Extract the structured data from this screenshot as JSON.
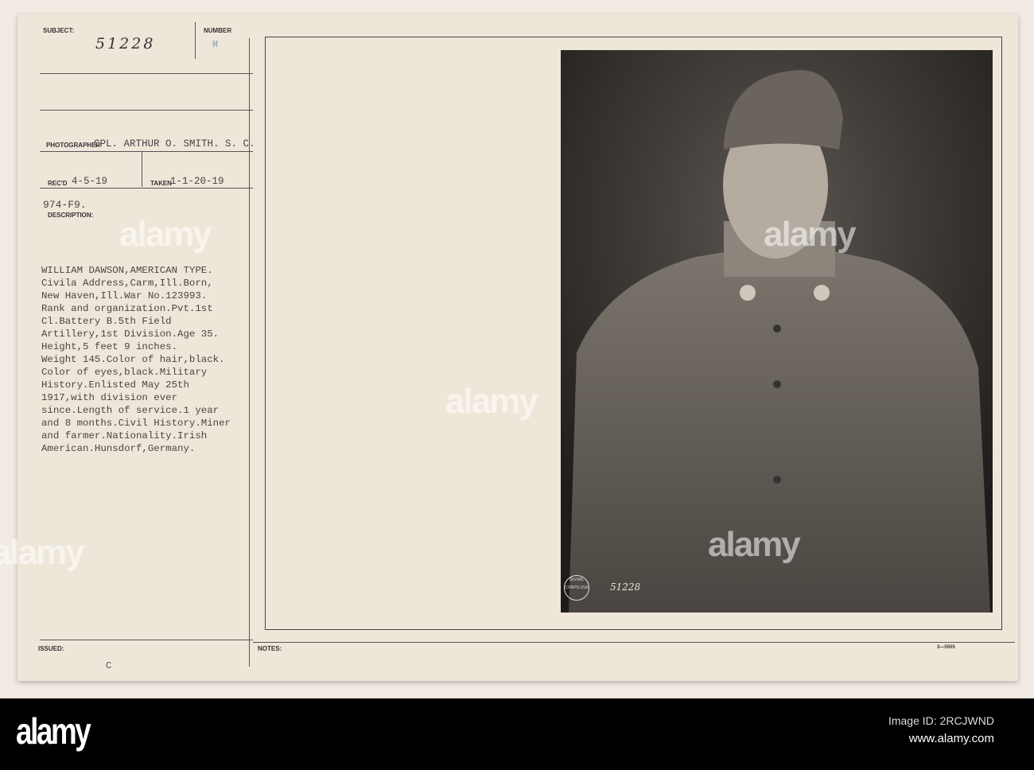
{
  "card": {
    "subject_label": "SUBJECT:",
    "subject_value": "51228",
    "number_label": "NUMBER",
    "number_value": "H",
    "photographer_label": "PHOTOGRAPHER",
    "photographer_value": "CPL. ARTHUR O. SMITH. S. C.",
    "recd_label": "REC'D",
    "recd_value": "4-5-19",
    "taken_label": "TAKEN",
    "taken_value": "1-1-20-19",
    "file_code": "974-F9.",
    "description_label": "DESCRIPTION:",
    "description_lines": [
      "WILLIAM DAWSON,AMERICAN TYPE.",
      "Civila Address,Carm,Ill.Born,",
      "New Haven,Ill.War No.123993.",
      "Rank and organization.Pvt.1st",
      "Cl.Battery B.5th Field",
      "Artillery,1st Division.Age 35.",
      "Height,5 feet 9 inches.",
      "Weight 145.Color of hair,black.",
      "Color of eyes,black.Military",
      "History.Enlisted May 25th",
      "1917,with division ever",
      "since.Length of service.1 year",
      "and 8 months.Civil History.Miner",
      "and farmer.Nationality.Irish",
      "American.Hunsdorf,Germany."
    ],
    "issued_label": "ISSUED:",
    "issued_value": "C",
    "notes_label": "NOTES:",
    "form_number": "3—5505",
    "photo_stamp_number": "51228",
    "photo_stamp_seal": "SIGNAL CORPS USA"
  },
  "watermark": {
    "brand": "alamy",
    "image_id": "Image ID: 2RCJWND",
    "url": "www.alamy.com"
  }
}
